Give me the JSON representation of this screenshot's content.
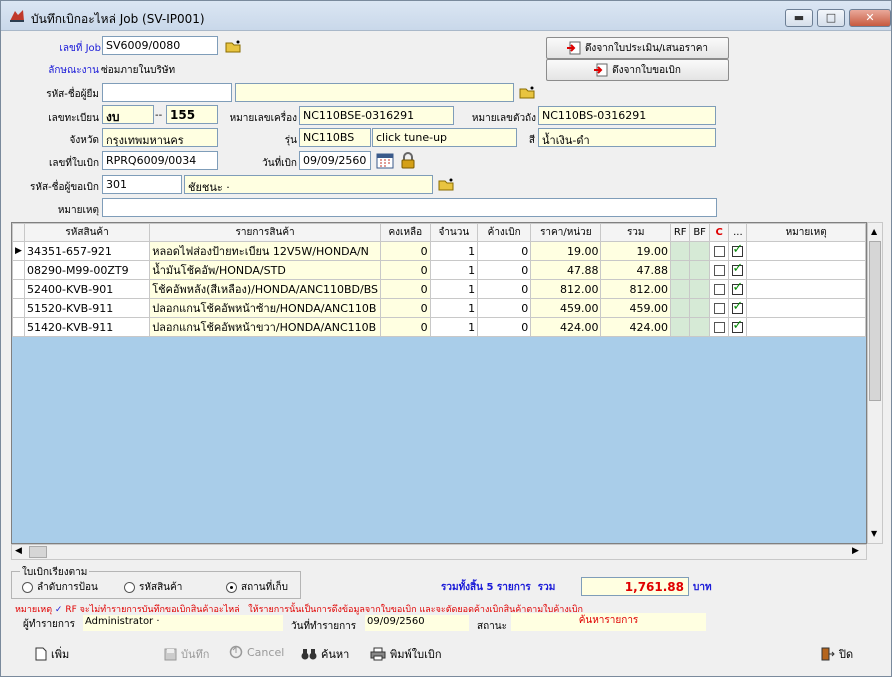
{
  "window": {
    "title": "บันทึกเบิกอะไหล่ Job (SV-IP001)",
    "min": "▬",
    "max": "□",
    "close": "✕"
  },
  "header": {
    "job_label": "เลขที่ Job",
    "job_value": "SV6009/0080",
    "jobtype_label": "ลักษณะงาน",
    "jobtype_value": "ซ่อมภายในบริษัท",
    "btn_from_estimate": "ดึงจากใบประเมิน/เสนอราคา",
    "btn_from_requisition": "ดึงจากใบขอเบิก",
    "borrower_label": "รหัส-ชื่อผู้ยืม",
    "borrower_code": "",
    "borrower_name": "",
    "plate_label": "เลขทะเบียน",
    "plate_prefix": "งบ",
    "plate_number": "155",
    "engine_label": "หมายเลขเครื่อง",
    "engine_value": "NC110BSE-0316291",
    "chassis_label": "หมายเลขตัวถัง",
    "chassis_value": "NC110BS-0316291",
    "province_label": "จังหวัด",
    "province_value": "กรุงเทพมหานคร",
    "model_label": "รุ่น",
    "model_code": "NC110BS",
    "model_name": "click tune-up",
    "color_label": "สี",
    "color_value": "น้ำเงิน-ดำ",
    "reqno_label": "เลขที่ใบเบิก",
    "reqno_value": "RPRQ6009/0034",
    "reqdate_label": "วันที่เบิก",
    "reqdate_value": "09/09/2560",
    "requester_label": "รหัส-ชื่อผู้ขอเบิก",
    "requester_code": "301",
    "requester_name": "ชัยชนะ ·",
    "remark_label": "หมายเหตุ",
    "remark_value": ""
  },
  "grid": {
    "columns": [
      "รหัสสินค้า",
      "รายการสินค้า",
      "คงเหลือ",
      "จำนวน",
      "ค้างเบิก",
      "ราคา/หน่วย",
      "รวม",
      "RF",
      "BF",
      "C",
      "...",
      "หมายเหตุ"
    ],
    "rows": [
      {
        "code": "34351-657-921",
        "name": "หลอดไฟส่องป้ายทะเบียน 12V5W/HONDA/N",
        "stock": "0",
        "qty": "1",
        "pending": "0",
        "price": "19.00",
        "total": "19.00"
      },
      {
        "code": "08290-M99-00ZT9",
        "name": "น้ำมันโช้คอัพ/HONDA/STD",
        "stock": "0",
        "qty": "1",
        "pending": "0",
        "price": "47.88",
        "total": "47.88"
      },
      {
        "code": "52400-KVB-901",
        "name": "โช้คอัพหลัง(สีเหลือง)/HONDA/ANC110BD/BS",
        "stock": "0",
        "qty": "1",
        "pending": "0",
        "price": "812.00",
        "total": "812.00"
      },
      {
        "code": "51520-KVB-911",
        "name": "ปลอกแกนโช้คอัพหน้าซ้าย/HONDA/ANC110B",
        "stock": "0",
        "qty": "1",
        "pending": "0",
        "price": "459.00",
        "total": "459.00"
      },
      {
        "code": "51420-KVB-911",
        "name": "ปลอกแกนโช้คอัพหน้าขวา/HONDA/ANC110B",
        "stock": "0",
        "qty": "1",
        "pending": "0",
        "price": "424.00",
        "total": "424.00"
      }
    ]
  },
  "sort": {
    "caption": "ใบเบิกเรียงตาม",
    "options": [
      "ลำดับการป้อน",
      "รหัสสินค้า",
      "สถานที่เก็บ"
    ],
    "selected": 2
  },
  "summary": {
    "label": "รวมทั้งสิ้น 5 รายการ  รวม",
    "total": "1,761.88",
    "currency": "บาท"
  },
  "note": {
    "prefix": "หมายเหตุ",
    "text": "RF จะไม่ทำรายการบันทึกขอเบิกสินค้าอะไหล่   ให้รายการนั้นเป็นการดึงข้อมูลจากใบขอเบิก และจะตัดยอดค้างเบิกสินค้าตามใบค้างเบิก"
  },
  "footer": {
    "user_label": "ผู้ทำรายการ",
    "user_value": "Administrator ·",
    "txdate_label": "วันที่ทำรายการ",
    "txdate_value": "09/09/2560",
    "status_label": "สถานะ",
    "status_value": "ค้นหารายการ"
  },
  "toolbar": {
    "add": "เพิ่ม",
    "save": "บันทึก",
    "cancel": "Cancel",
    "search": "ค้นหา",
    "print": "พิมพ์ใบเบิก",
    "close": "ปิด"
  },
  "colors": {
    "grid_bg": "#a9cde9",
    "readonly": "#ffffe1",
    "total_text": "#e00000",
    "label_blue": "#1a1ad8"
  }
}
